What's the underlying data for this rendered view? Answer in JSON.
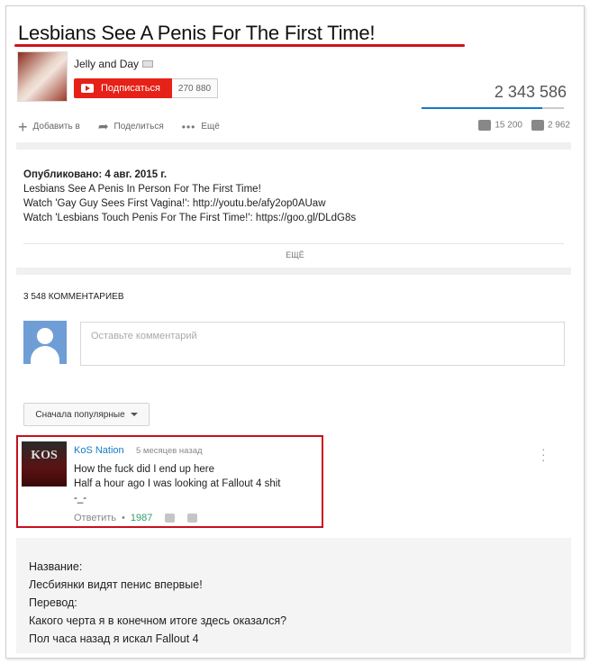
{
  "video": {
    "title": "Lesbians See A Penis For The First Time!",
    "views": "2 343 586",
    "views_bar_fraction": 0.85
  },
  "channel": {
    "name": "Jelly and Day",
    "subscribe_label": "Подписаться",
    "subscriber_count": "270 880"
  },
  "actions": {
    "add_label": "Добавить в",
    "share_label": "Поделиться",
    "more_label": "Ещё",
    "likes": "15 200",
    "dislikes": "2 962"
  },
  "description": {
    "published": "Опубликовано: 4 авг. 2015 г.",
    "line1": "Lesbians See A Penis In Person For The First Time!",
    "line2": "Watch 'Gay Guy Sees First Vagina!': http://youtu.be/afy2op0AUaw",
    "line3": "Watch 'Lesbians Touch Penis For The First Time!': https://goo.gl/DLdG8s",
    "more_label": "ЕЩЁ"
  },
  "comments": {
    "count_label": "3 548 КОММЕНТАРИЕВ",
    "placeholder": "Оставьте комментарий",
    "sort_label": "Сначала популярные"
  },
  "comment": {
    "avatar_text": "KOS",
    "author": "KoS Nation",
    "time": "5 месяцев назад",
    "line1": "How the fuck did I end up here",
    "line2": "Half a hour ago I was looking at Fallout 4 shit",
    "line3": "-_-",
    "reply_label": "Ответить",
    "likes": "1987"
  },
  "translation": {
    "line1": "Название:",
    "line2": "Лесбиянки видят пенис впервые!",
    "line3": "Перевод:",
    "line4": "Какого черта я в конечном итоге здесь оказался?",
    "line5": "Пол часа назад я искал Fallout 4"
  },
  "colors": {
    "accent_red": "#e62117",
    "highlight_red": "#c8101d",
    "link_blue": "#167ac6"
  }
}
